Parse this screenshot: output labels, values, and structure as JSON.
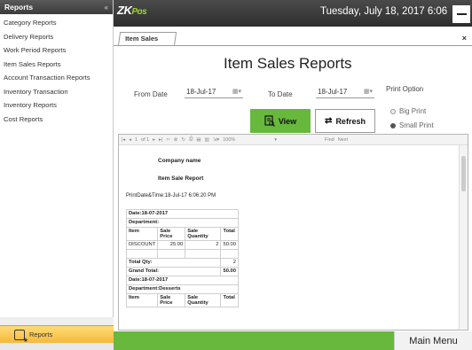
{
  "sidebar": {
    "header": "Reports",
    "collapse_icon": "double-chevron-left-icon",
    "items": [
      {
        "label": "Category Reports"
      },
      {
        "label": "Delivery Reports"
      },
      {
        "label": "Work Period Reports"
      },
      {
        "label": "Item Sales Reports"
      },
      {
        "label": "Account Transaction Reports"
      },
      {
        "label": "Inventory Transaction"
      },
      {
        "label": "Inventory Reports"
      },
      {
        "label": "Cost Reports"
      }
    ],
    "footer_label": "Reports"
  },
  "topbar": {
    "logo_main": "ZK",
    "logo_accent": "Pos",
    "datetime": "Tuesday, July 18, 2017 6:06"
  },
  "tab": {
    "label": "Item Sales",
    "close": "×"
  },
  "page": {
    "title": "Item Sales Reports",
    "from_label": "From Date",
    "from_value": "18-Jul-17",
    "to_label": "To Date",
    "to_value": "18-Jul-17",
    "print_option_label": "Print Option",
    "view_label": "View",
    "refresh_label": "Refresh",
    "big_print": "Big Print",
    "small_print": "Small Print",
    "selected_print": "Small Print"
  },
  "viewer_toolbar": {
    "page_current": "1",
    "page_of": "of 1",
    "zoom": "100%",
    "find": "Find",
    "next": "Next"
  },
  "report": {
    "company": "Company name",
    "title": "Item Sale Report",
    "print_time": "PrintDate&Time:18-Jul-17 6:06:20 PM",
    "rows": [
      {
        "c1": "Date:18-07-2017",
        "c2": "",
        "c3": "",
        "c4": "",
        "type": "hdr"
      },
      {
        "c1": "Department:",
        "c2": "",
        "c3": "",
        "c4": "",
        "type": "hdr"
      },
      {
        "c1": "Item",
        "c2": "Sale Price",
        "c3": "Sale Quantity",
        "c4": "Total",
        "type": "col"
      },
      {
        "c1": "DISCOUNT",
        "c2": "25.00",
        "c3": "2",
        "c4": "50.00",
        "type": "data"
      },
      {
        "c1": "",
        "c2": "",
        "c3": "",
        "c4": "",
        "type": "spacer"
      },
      {
        "c1": "Total Qty:",
        "c2": "",
        "c3": "",
        "c4": "2",
        "type": "total"
      },
      {
        "c1": "Grand Total:",
        "c2": "",
        "c3": "",
        "c4": "50.00",
        "type": "totalb"
      },
      {
        "c1": "Date:18-07-2017",
        "c2": "",
        "c3": "",
        "c4": "",
        "type": "hdr"
      },
      {
        "c1": "Department:Desserts",
        "c2": "",
        "c3": "",
        "c4": "",
        "type": "hdr"
      },
      {
        "c1": "Item",
        "c2": "Sale Price",
        "c3": "Sale Quantity",
        "c4": "Total",
        "type": "col"
      }
    ]
  },
  "bottom": {
    "main_menu": "Main Menu"
  }
}
